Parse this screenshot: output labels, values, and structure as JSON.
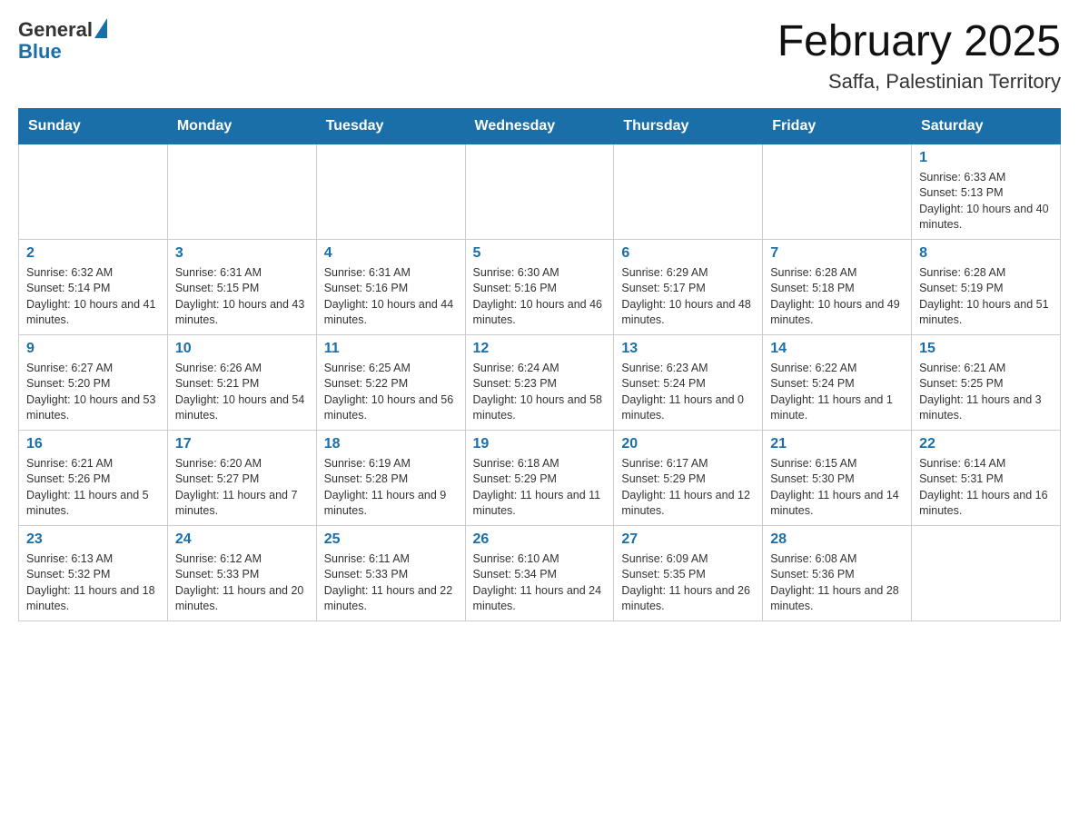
{
  "header": {
    "title": "February 2025",
    "subtitle": "Saffa, Palestinian Territory",
    "logo_general": "General",
    "logo_blue": "Blue"
  },
  "weekdays": [
    "Sunday",
    "Monday",
    "Tuesday",
    "Wednesday",
    "Thursday",
    "Friday",
    "Saturday"
  ],
  "weeks": [
    [
      {
        "day": "",
        "info": ""
      },
      {
        "day": "",
        "info": ""
      },
      {
        "day": "",
        "info": ""
      },
      {
        "day": "",
        "info": ""
      },
      {
        "day": "",
        "info": ""
      },
      {
        "day": "",
        "info": ""
      },
      {
        "day": "1",
        "info": "Sunrise: 6:33 AM\nSunset: 5:13 PM\nDaylight: 10 hours and 40 minutes."
      }
    ],
    [
      {
        "day": "2",
        "info": "Sunrise: 6:32 AM\nSunset: 5:14 PM\nDaylight: 10 hours and 41 minutes."
      },
      {
        "day": "3",
        "info": "Sunrise: 6:31 AM\nSunset: 5:15 PM\nDaylight: 10 hours and 43 minutes."
      },
      {
        "day": "4",
        "info": "Sunrise: 6:31 AM\nSunset: 5:16 PM\nDaylight: 10 hours and 44 minutes."
      },
      {
        "day": "5",
        "info": "Sunrise: 6:30 AM\nSunset: 5:16 PM\nDaylight: 10 hours and 46 minutes."
      },
      {
        "day": "6",
        "info": "Sunrise: 6:29 AM\nSunset: 5:17 PM\nDaylight: 10 hours and 48 minutes."
      },
      {
        "day": "7",
        "info": "Sunrise: 6:28 AM\nSunset: 5:18 PM\nDaylight: 10 hours and 49 minutes."
      },
      {
        "day": "8",
        "info": "Sunrise: 6:28 AM\nSunset: 5:19 PM\nDaylight: 10 hours and 51 minutes."
      }
    ],
    [
      {
        "day": "9",
        "info": "Sunrise: 6:27 AM\nSunset: 5:20 PM\nDaylight: 10 hours and 53 minutes."
      },
      {
        "day": "10",
        "info": "Sunrise: 6:26 AM\nSunset: 5:21 PM\nDaylight: 10 hours and 54 minutes."
      },
      {
        "day": "11",
        "info": "Sunrise: 6:25 AM\nSunset: 5:22 PM\nDaylight: 10 hours and 56 minutes."
      },
      {
        "day": "12",
        "info": "Sunrise: 6:24 AM\nSunset: 5:23 PM\nDaylight: 10 hours and 58 minutes."
      },
      {
        "day": "13",
        "info": "Sunrise: 6:23 AM\nSunset: 5:24 PM\nDaylight: 11 hours and 0 minutes."
      },
      {
        "day": "14",
        "info": "Sunrise: 6:22 AM\nSunset: 5:24 PM\nDaylight: 11 hours and 1 minute."
      },
      {
        "day": "15",
        "info": "Sunrise: 6:21 AM\nSunset: 5:25 PM\nDaylight: 11 hours and 3 minutes."
      }
    ],
    [
      {
        "day": "16",
        "info": "Sunrise: 6:21 AM\nSunset: 5:26 PM\nDaylight: 11 hours and 5 minutes."
      },
      {
        "day": "17",
        "info": "Sunrise: 6:20 AM\nSunset: 5:27 PM\nDaylight: 11 hours and 7 minutes."
      },
      {
        "day": "18",
        "info": "Sunrise: 6:19 AM\nSunset: 5:28 PM\nDaylight: 11 hours and 9 minutes."
      },
      {
        "day": "19",
        "info": "Sunrise: 6:18 AM\nSunset: 5:29 PM\nDaylight: 11 hours and 11 minutes."
      },
      {
        "day": "20",
        "info": "Sunrise: 6:17 AM\nSunset: 5:29 PM\nDaylight: 11 hours and 12 minutes."
      },
      {
        "day": "21",
        "info": "Sunrise: 6:15 AM\nSunset: 5:30 PM\nDaylight: 11 hours and 14 minutes."
      },
      {
        "day": "22",
        "info": "Sunrise: 6:14 AM\nSunset: 5:31 PM\nDaylight: 11 hours and 16 minutes."
      }
    ],
    [
      {
        "day": "23",
        "info": "Sunrise: 6:13 AM\nSunset: 5:32 PM\nDaylight: 11 hours and 18 minutes."
      },
      {
        "day": "24",
        "info": "Sunrise: 6:12 AM\nSunset: 5:33 PM\nDaylight: 11 hours and 20 minutes."
      },
      {
        "day": "25",
        "info": "Sunrise: 6:11 AM\nSunset: 5:33 PM\nDaylight: 11 hours and 22 minutes."
      },
      {
        "day": "26",
        "info": "Sunrise: 6:10 AM\nSunset: 5:34 PM\nDaylight: 11 hours and 24 minutes."
      },
      {
        "day": "27",
        "info": "Sunrise: 6:09 AM\nSunset: 5:35 PM\nDaylight: 11 hours and 26 minutes."
      },
      {
        "day": "28",
        "info": "Sunrise: 6:08 AM\nSunset: 5:36 PM\nDaylight: 11 hours and 28 minutes."
      },
      {
        "day": "",
        "info": ""
      }
    ]
  ]
}
